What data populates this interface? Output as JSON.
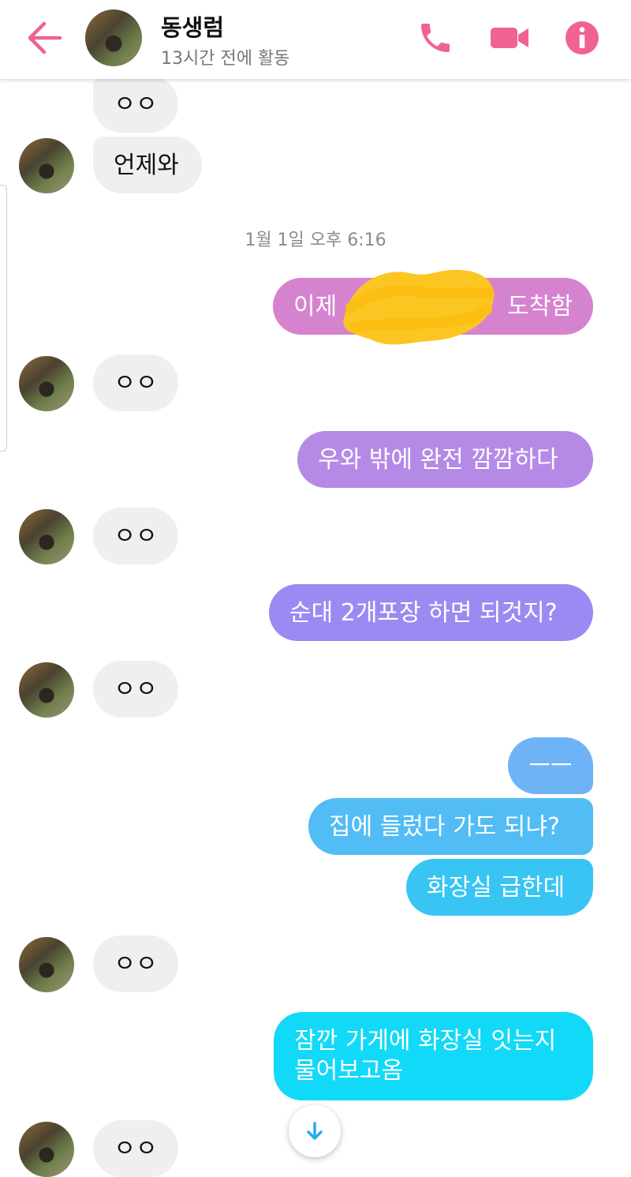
{
  "header": {
    "contact_name": "동생럼",
    "status": "13시간 전에 활동"
  },
  "colors": {
    "accent": "#f06292",
    "incoming_bubble": "#efefef",
    "outgoing_1": "#d683cf",
    "outgoing_2": "#b48ae6",
    "outgoing_3": "#9a8bf2",
    "outgoing_4": "#6fb3f7",
    "outgoing_5": "#38c5f3",
    "outgoing_6": "#12d9f8"
  },
  "icons": {
    "back": "arrow-left-icon",
    "call": "phone-icon",
    "video": "video-camera-icon",
    "info": "info-icon",
    "scroll": "arrow-down-icon"
  },
  "messages": {
    "m1": "ㅇㅇ",
    "m2": "언제와",
    "timestamp": "1월 1일 오후 6:16",
    "m3_start": "이제",
    "m3_end": "도착함",
    "m4": "ㅇㅇ",
    "m5": "우와 밖에 완전 깜깜하다",
    "m6": "ㅇㅇ",
    "m7": "순대 2개포장 하면 되것지?",
    "m8": "ㅇㅇ",
    "m9": "ㅡㅡ",
    "m10": "집에 들렀다 가도 되냐?",
    "m11": "화장실 급한데",
    "m12": "ㅇㅇ",
    "m13_line1": "잠깐 가게에 화장실 잇는지",
    "m13_line2": "물어보고옴",
    "m14": "ㅇㅇ"
  }
}
